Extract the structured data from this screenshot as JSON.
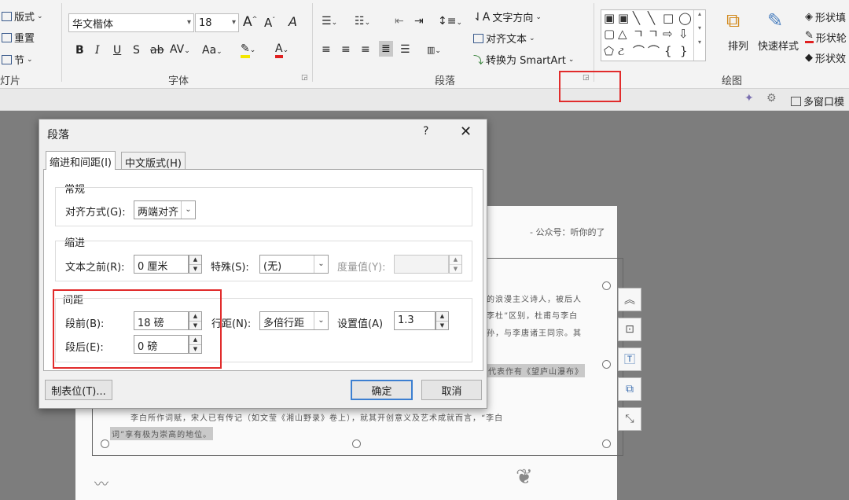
{
  "ribbon": {
    "slides_group": {
      "layout": "版式",
      "reset": "重置",
      "section": "节",
      "label": "灯片"
    },
    "font_group": {
      "font_name": "华文楷体",
      "font_size": "18",
      "grow": "A",
      "shrink": "A",
      "clear": "A",
      "bold": "B",
      "italic": "I",
      "underline": "U",
      "shadow": "S",
      "strike": "ab",
      "spacing": "AV",
      "case": "Aa",
      "label": "字体"
    },
    "paragraph_group": {
      "text_direction": "文字方向",
      "align_text": "对齐文本",
      "smartart": "转换为 SmartArt",
      "label": "段落"
    },
    "drawing_group": {
      "arrange": "排列",
      "quick_styles": "快速样式",
      "shape_fill": "形状填",
      "shape_outline": "形状轮",
      "shape_effects": "形状效",
      "label": "绘图"
    }
  },
  "subbar": {
    "multiwindow": "多窗口模"
  },
  "slide": {
    "header_text": "- 公众号：听你的了",
    "lines": [
      "的浪漫主义诗人，被后人",
      "李杜”区别，杜甫与李白",
      "孙，与李唐诸王同宗。其",
      "代表作有《望庐山瀑布》",
      "李白所作词赋，宋人已有传记（如文莹《湘山野录》卷上），就其开创意义及艺术成就而言，“李白",
      "词”享有极为崇高的地位。"
    ]
  },
  "dialog": {
    "title": "段落",
    "help": "?",
    "close": "✕",
    "tabs": [
      "缩进和间距(I)",
      "中文版式(H)"
    ],
    "general": {
      "title": "常规",
      "alignment_label": "对齐方式(G):",
      "alignment_value": "两端对齐"
    },
    "indent": {
      "title": "缩进",
      "before_text_label": "文本之前(R):",
      "before_text_value": "0 厘米",
      "special_label": "特殊(S):",
      "special_value": "(无)",
      "by_label": "度量值(Y):",
      "by_value": ""
    },
    "spacing": {
      "title": "间距",
      "before_label": "段前(B):",
      "before_value": "18 磅",
      "after_label": "段后(E):",
      "after_value": "0 磅",
      "line_label": "行距(N):",
      "line_value": "多倍行距",
      "at_label": "设置值(A)",
      "at_value": "1.3"
    },
    "tabs_button": "制表位(T)...",
    "ok": "确定",
    "cancel": "取消"
  },
  "colors": {
    "highlight_box": "#e12b2b",
    "primary_border": "#3c7fd1"
  }
}
